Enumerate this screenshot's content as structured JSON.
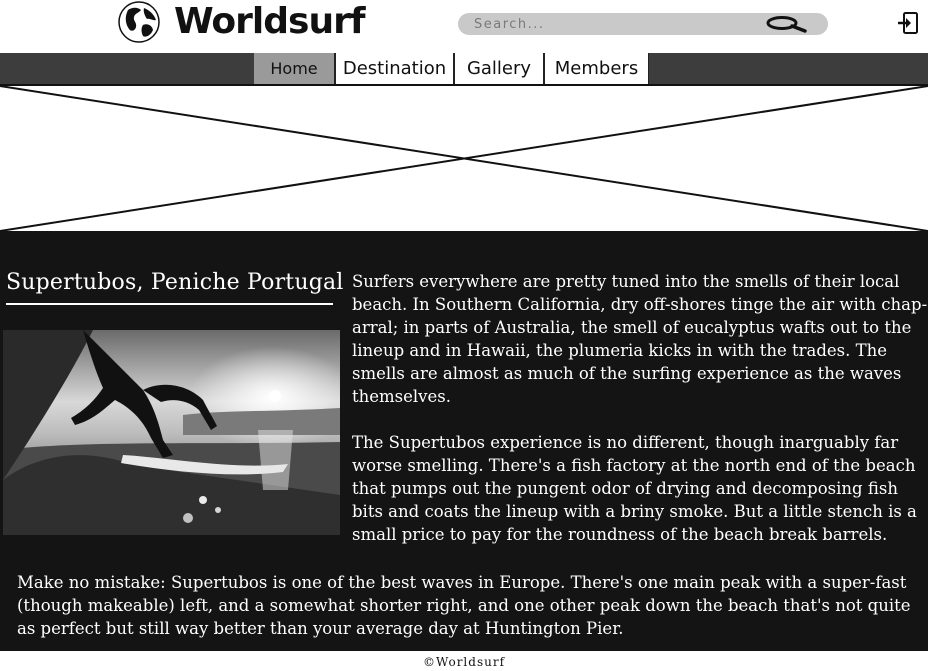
{
  "header": {
    "logo_text": "Worldsurf",
    "search_placeholder": "Search...",
    "icons": [
      "globe-icon",
      "search-icon",
      "login-icon"
    ]
  },
  "nav": {
    "tabs": [
      {
        "label": "Home",
        "active": true
      },
      {
        "label": "Destination",
        "active": false
      },
      {
        "label": "Gallery",
        "active": false
      },
      {
        "label": "Members",
        "active": false
      }
    ]
  },
  "article": {
    "title": "Supertubos, Peniche Portugal",
    "paragraphs": [
      "Surfers everywhere are pretty tuned into the smells of their local beach. In Southern California, dry off-shores tinge the air with chap-arral; in parts of Australia, the smell of eucalyptus wafts out to the lineup and in Hawaii, the plumeria kicks in with the trades. The smells are almost as much of the surfing experience as the waves themselves.",
      "The Supertubos experience is no different, though inarguably far worse smelling. There's a fish factory at the north end of the beach that pumps out the pungent odor of drying and decomposing fish bits and coats the lineup with a briny smoke. But a little stench is a small price to pay for the roundness of the beach break barrels.",
      "Make no mistake: Supertubos is one of the best waves in Europe. There's one main peak with a super-fast (though makeable) left, and a somewhat shorter right, and one other peak down the beach that's not quite as perfect but still way better than your average day at Huntington Pier."
    ]
  },
  "footer": {
    "copyright": "©Worldsurf"
  },
  "colors": {
    "content_bg": "#141414",
    "nav_bg": "#3d3d3d",
    "active_tab": "#9a9a9a",
    "search_bg": "#c9c9c9"
  }
}
